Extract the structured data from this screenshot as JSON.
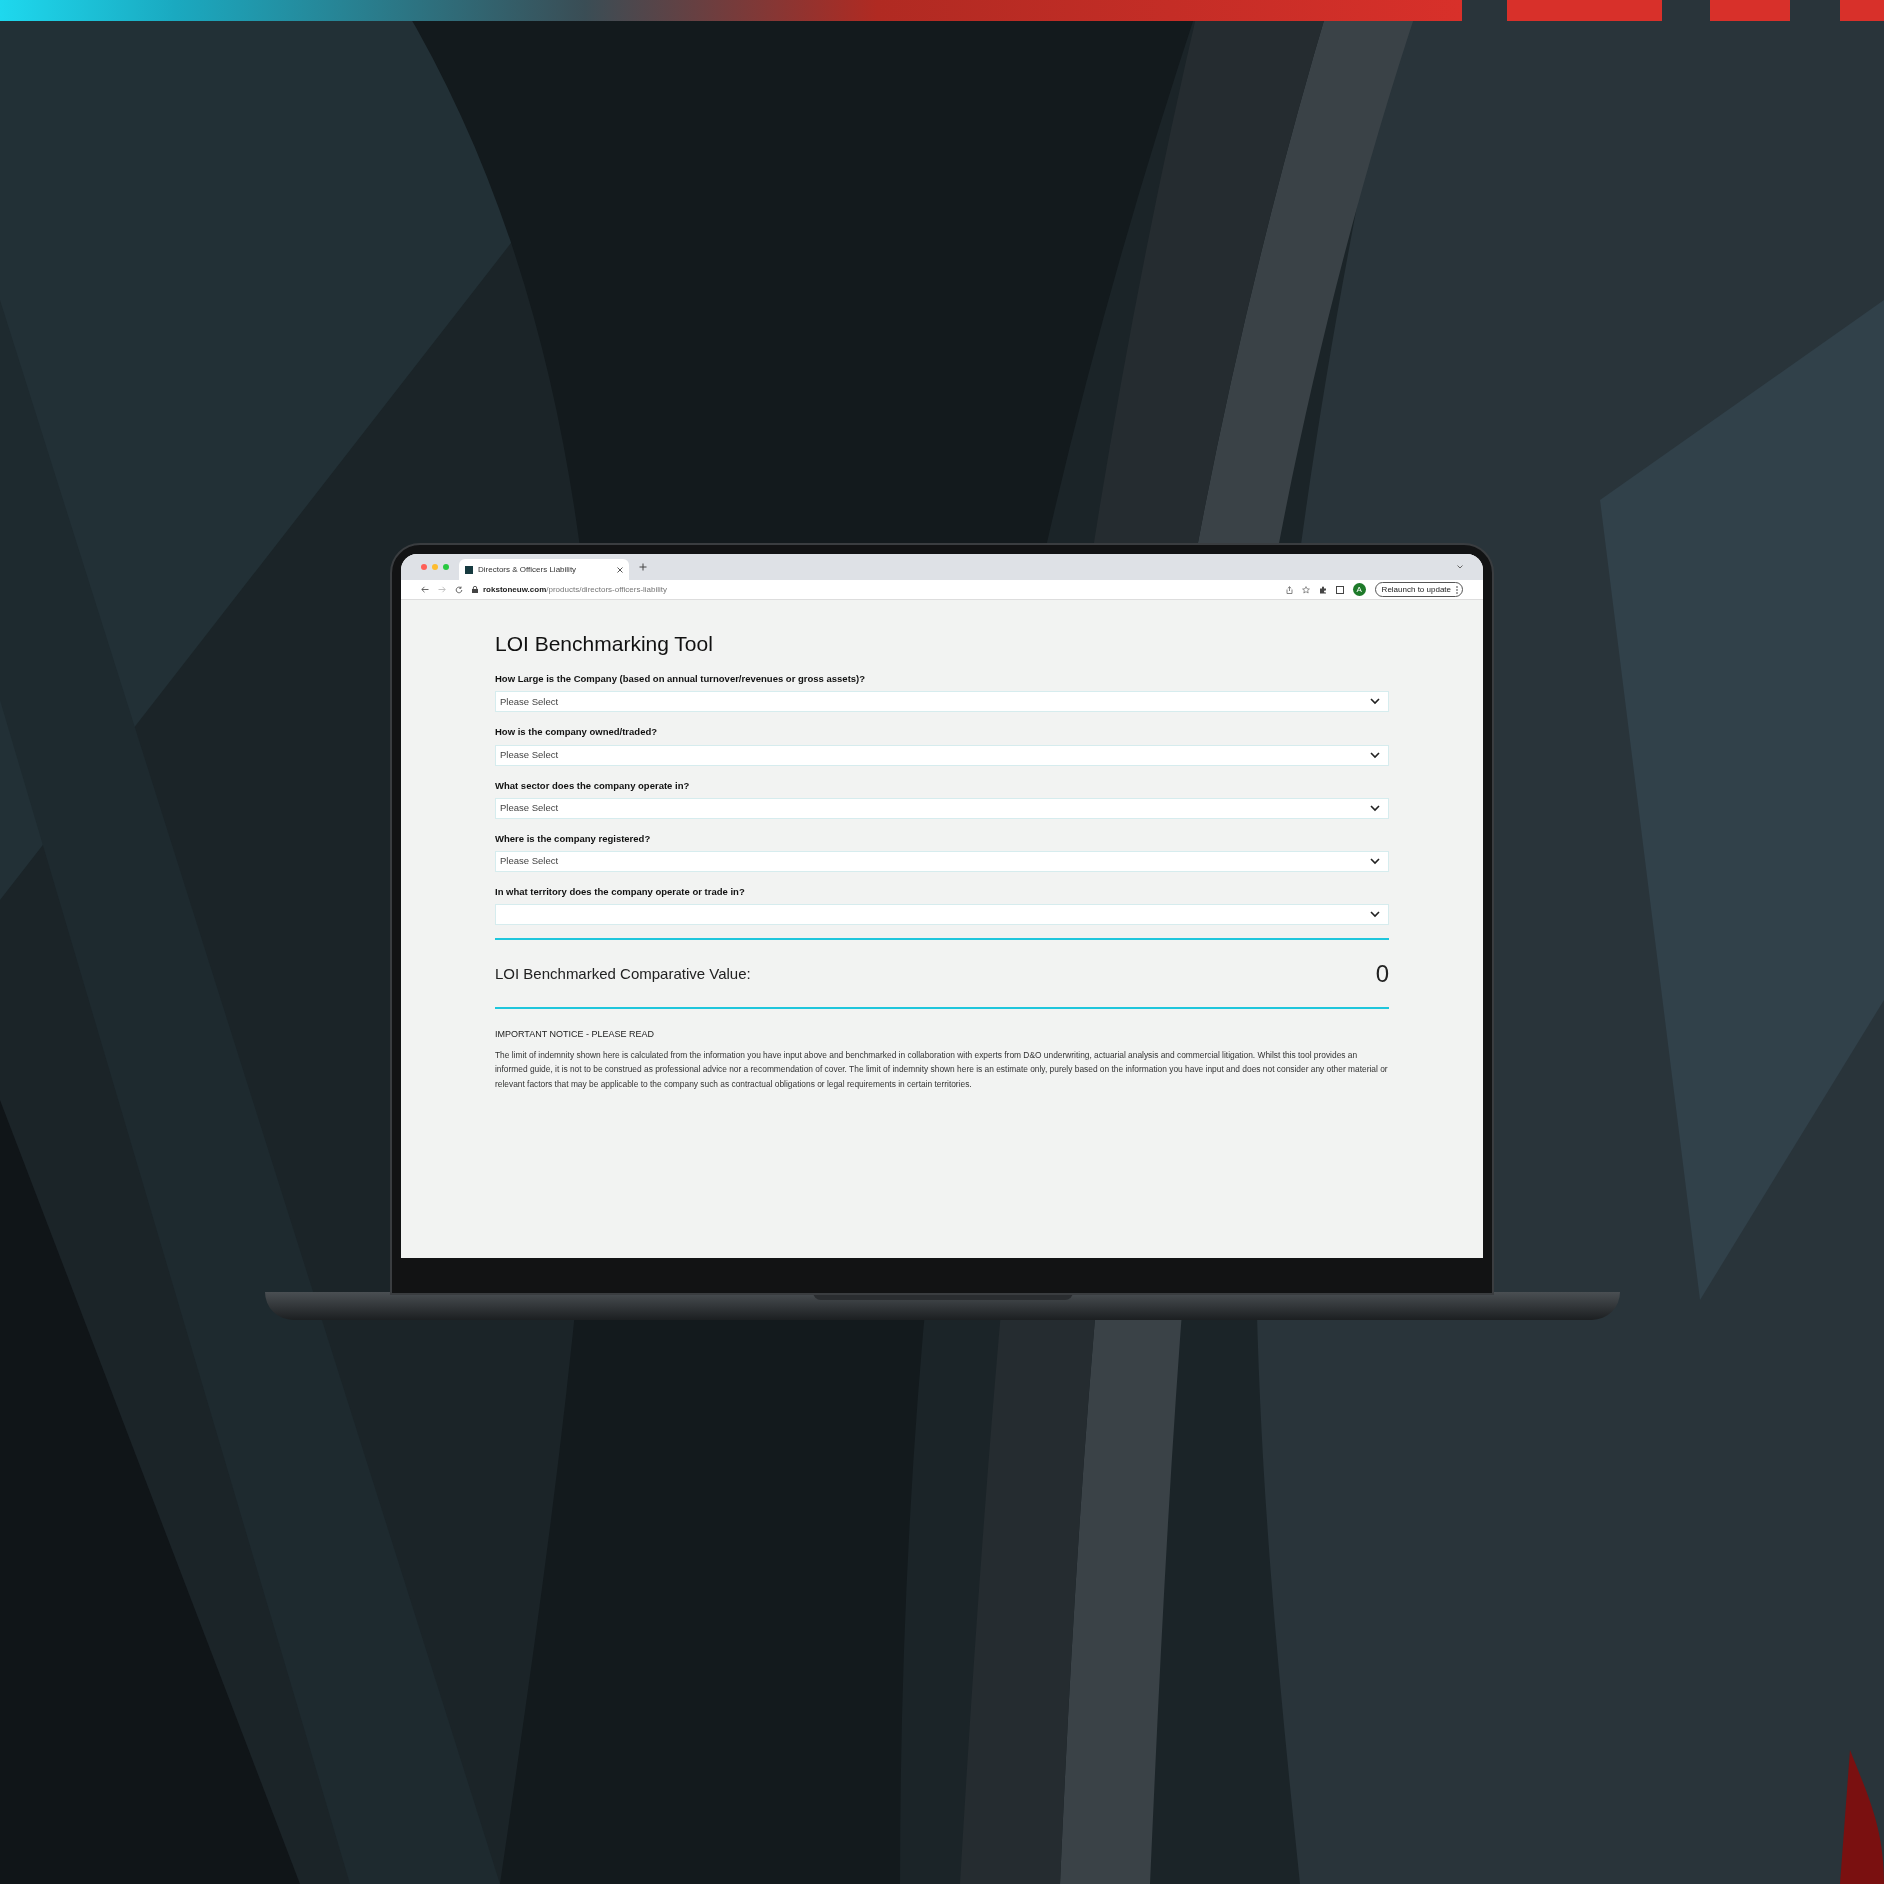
{
  "browser": {
    "tab_title": "Directors & Officers Liability",
    "url_domain": "rokstoneuw.com",
    "url_path": "/products/directors-officers-liability",
    "profile_initial": "A",
    "relaunch_button": "Relaunch to update"
  },
  "page": {
    "title": "LOI Benchmarking Tool",
    "questions": [
      {
        "label": "How Large is the Company (based on annual turnover/revenues or gross assets)?",
        "placeholder": "Please Select"
      },
      {
        "label": "How is the company owned/traded?",
        "placeholder": "Please Select"
      },
      {
        "label": "What sector does the company operate in?",
        "placeholder": "Please Select"
      },
      {
        "label": "Where is the company registered?",
        "placeholder": "Please Select"
      },
      {
        "label": "In what territory does the company operate or trade in?"
      }
    ],
    "result": {
      "label": "LOI Benchmarked Comparative Value:",
      "value": "0"
    },
    "notice": {
      "heading": "IMPORTANT NOTICE - PLEASE READ",
      "body": "The limit of indemnity shown here is calculated from the information you have input above and benchmarked in collaboration with experts from D&O underwriting, actuarial analysis and commercial litigation. Whilst this tool provides an informed guide, it is not to be construed as professional advice nor a recommendation of cover. The limit of indemnity shown here is an estimate only, purely based on the information you have input and does not consider any other material or relevant factors that may be applicable to the company such as contractual obligations or legal requirements in certain territories."
    }
  }
}
